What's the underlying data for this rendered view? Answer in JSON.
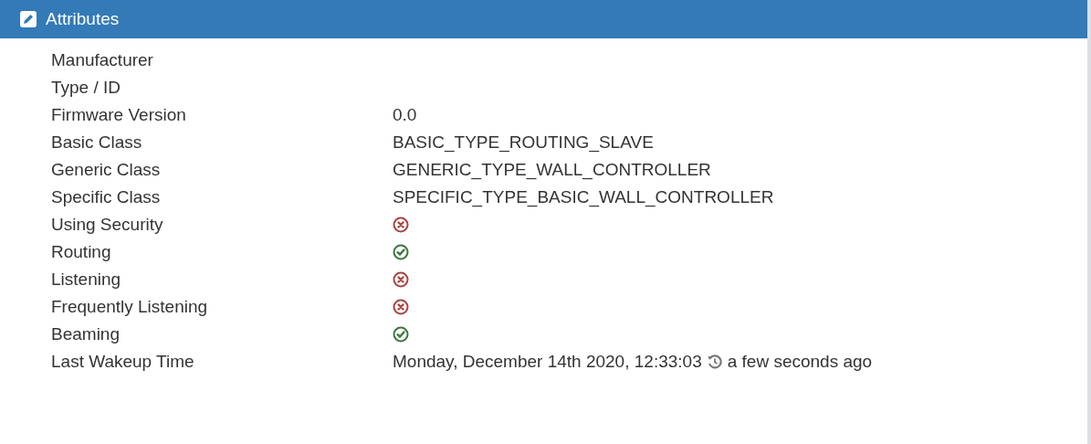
{
  "panel": {
    "title": "Attributes"
  },
  "rows": [
    {
      "label": "Manufacturer",
      "kind": "text"
    },
    {
      "label": "Type / ID",
      "kind": "text"
    },
    {
      "label": "Firmware Version",
      "kind": "text",
      "value": "0.0"
    },
    {
      "label": "Basic Class",
      "kind": "text",
      "value": "BASIC_TYPE_ROUTING_SLAVE"
    },
    {
      "label": "Generic Class",
      "kind": "text",
      "value": "GENERIC_TYPE_WALL_CONTROLLER"
    },
    {
      "label": "Specific Class",
      "kind": "text",
      "value": "SPECIFIC_TYPE_BASIC_WALL_CONTROLLER"
    },
    {
      "label": "Using Security",
      "kind": "flag",
      "on": false
    },
    {
      "label": "Routing",
      "kind": "flag",
      "on": true
    },
    {
      "label": "Listening",
      "kind": "flag",
      "on": false
    },
    {
      "label": "Frequently Listening",
      "kind": "flag",
      "on": false
    },
    {
      "label": "Beaming",
      "kind": "flag",
      "on": true
    },
    {
      "label": "Last Wakeup Time",
      "kind": "time",
      "value": "Monday, December 14th 2020, 12:33:03",
      "relative": "a few seconds ago"
    }
  ]
}
